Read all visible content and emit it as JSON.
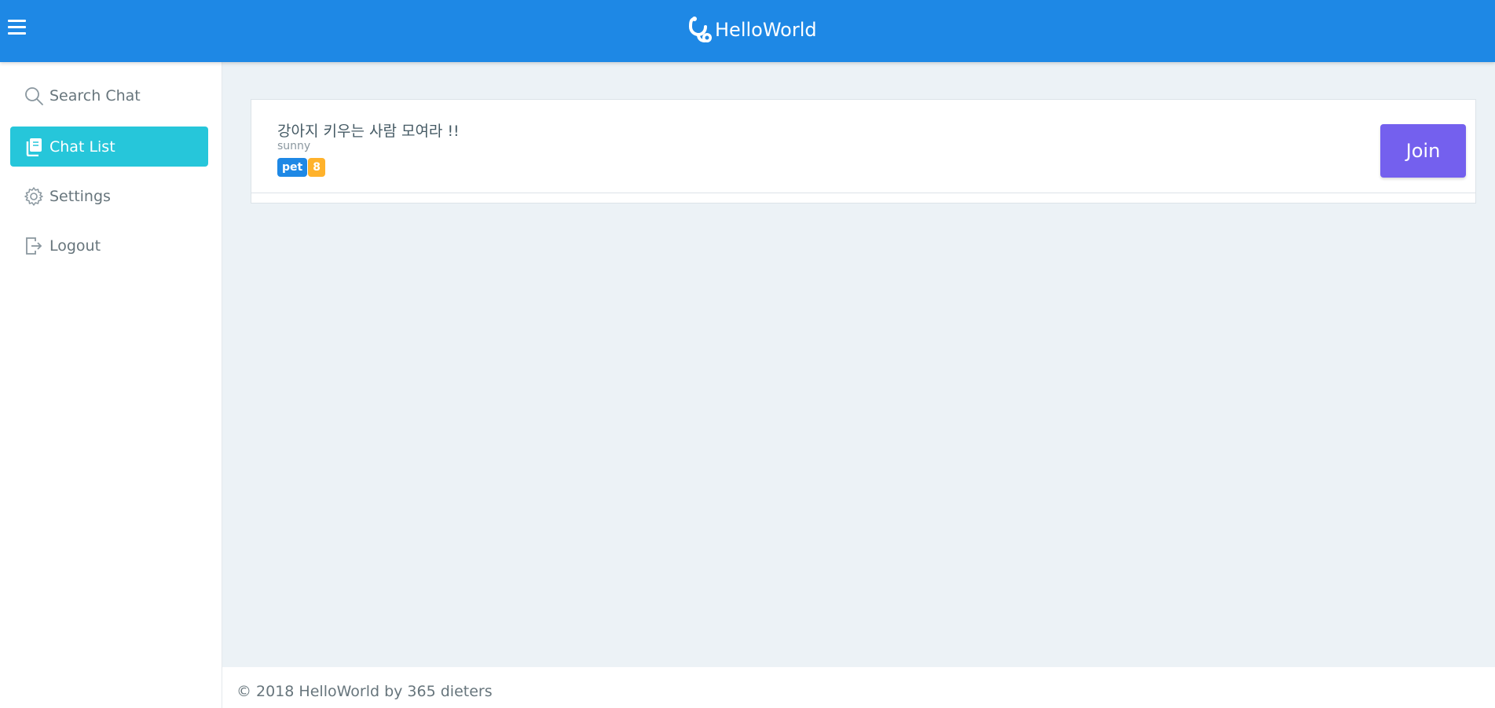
{
  "header": {
    "brand_name": "HelloWorld",
    "menu_icon": "hamburger-menu-icon",
    "logo_icon": "stethoscope-logo-icon",
    "background_color": "#1e88e5"
  },
  "sidebar": {
    "items": [
      {
        "label": "Search Chat",
        "icon": "search-icon",
        "active": false
      },
      {
        "label": "Chat List",
        "icon": "chat-list-icon",
        "active": true
      },
      {
        "label": "Settings",
        "icon": "gear-icon",
        "active": false
      },
      {
        "label": "Logout",
        "icon": "logout-icon",
        "active": false
      }
    ],
    "active_color": "#26c6da"
  },
  "chat_list": {
    "rooms": [
      {
        "title": "강아지 키우는 사람 모여라 !!",
        "owner": "sunny",
        "tag": "pet",
        "count": "8",
        "join_label": "Join"
      }
    ]
  },
  "colors": {
    "join_button": "#7460ee",
    "tag_badge": "#1e88e5",
    "count_badge": "#ffb22b",
    "page_background": "#ecf2f6"
  },
  "footer": {
    "text": "© 2018 HelloWorld by 365 dieters"
  }
}
